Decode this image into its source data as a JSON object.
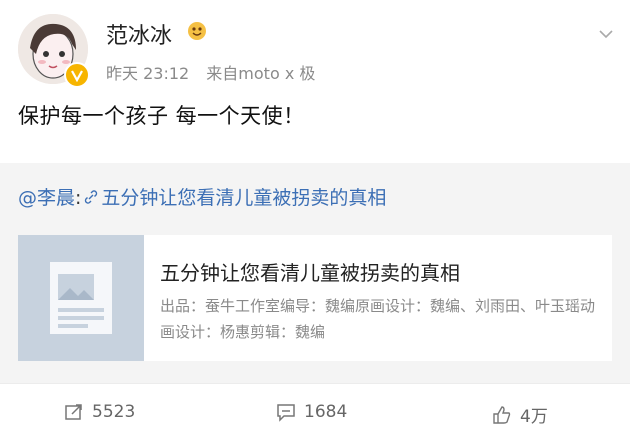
{
  "post": {
    "author": "范冰冰",
    "time": "昨天 23:12",
    "source": "来自moto x 极",
    "text": "保护每一个孩子 每一个天使！"
  },
  "repost": {
    "user": "@李晨",
    "sep": ":",
    "text": "五分钟让您看清儿童被拐卖的真相",
    "card": {
      "title": "五分钟让您看清儿童被拐卖的真相",
      "desc": "出品：蚕牛工作室编导：魏编原画设计：魏编、刘雨田、叶玉瑶动画设计：杨惠剪辑：魏编"
    }
  },
  "actions": {
    "repost_count": "5523",
    "comment_count": "1684",
    "like_count": "4万"
  },
  "colors": {
    "link": "#3c6fb5",
    "verified": "#f7b500"
  },
  "icons": [
    "verified-icon",
    "emoji-icon",
    "chevron-down-icon",
    "link-icon",
    "article-thumbnail-icon",
    "repost-icon",
    "comment-icon",
    "like-icon"
  ]
}
